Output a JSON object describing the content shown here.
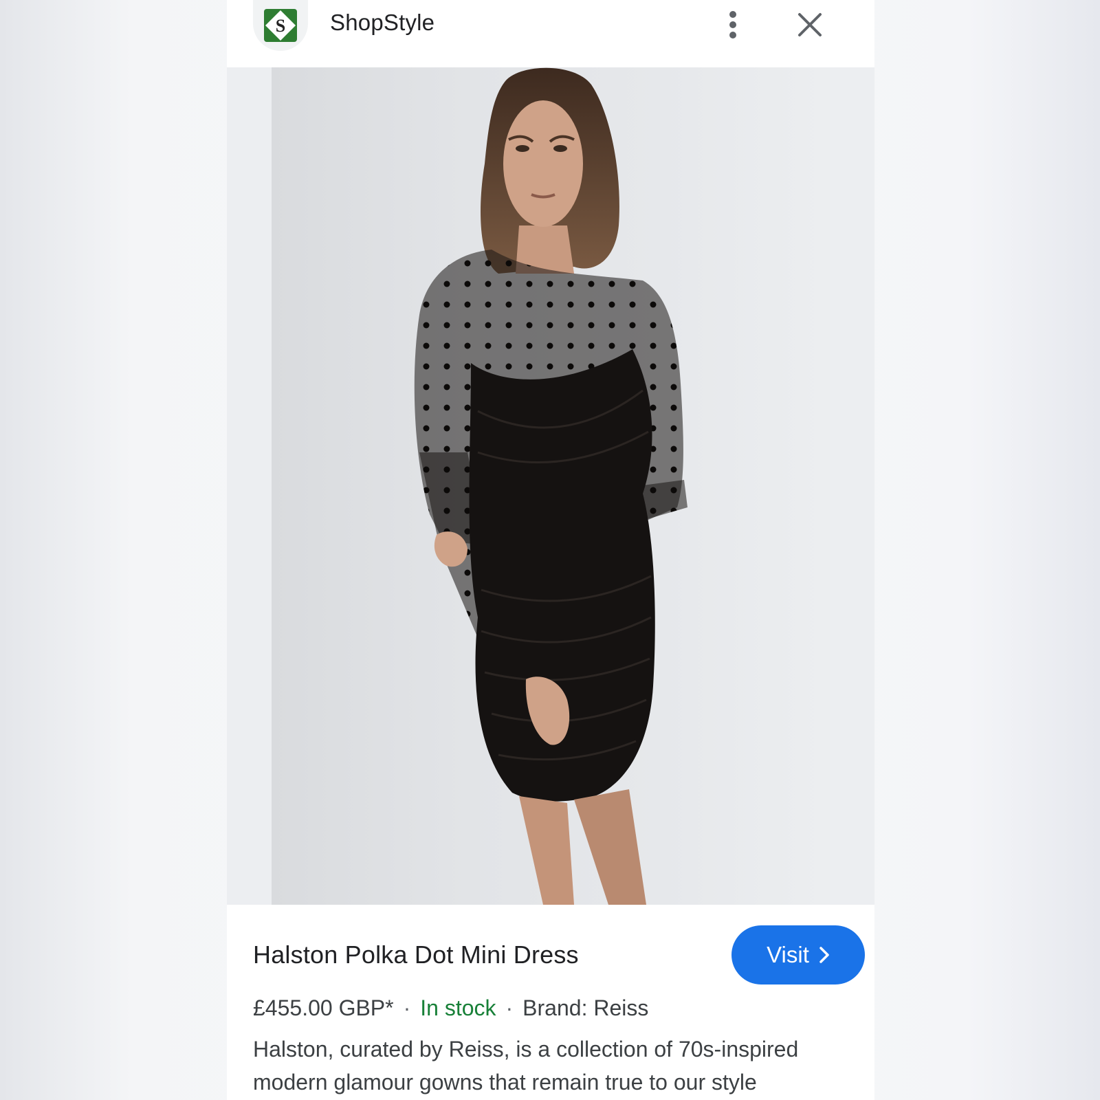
{
  "header": {
    "site_name": "ShopStyle",
    "logo_letter": "S",
    "logo_icon": "shopstyle-logo-icon",
    "menu_icon": "more-vert-icon",
    "close_icon": "close-icon"
  },
  "product": {
    "image_icon": "product-photo",
    "title": "Halston Polka Dot Mini Dress",
    "price": "£455.00 GBP*",
    "separator": "·",
    "availability": "In stock",
    "brand": "Brand: Reiss",
    "description_line1": "Halston, curated by Reiss, is a collection of 70s-inspired",
    "description_line2": "modern glamour gowns that remain true to our style"
  },
  "actions": {
    "visit_label": "Visit",
    "visit_icon": "chevron-right-icon"
  },
  "colors": {
    "accent": "#1a73e8",
    "in_stock": "#188038",
    "text_primary": "#202124",
    "text_secondary": "#3c4043",
    "logo_green": "#2e7d32"
  }
}
